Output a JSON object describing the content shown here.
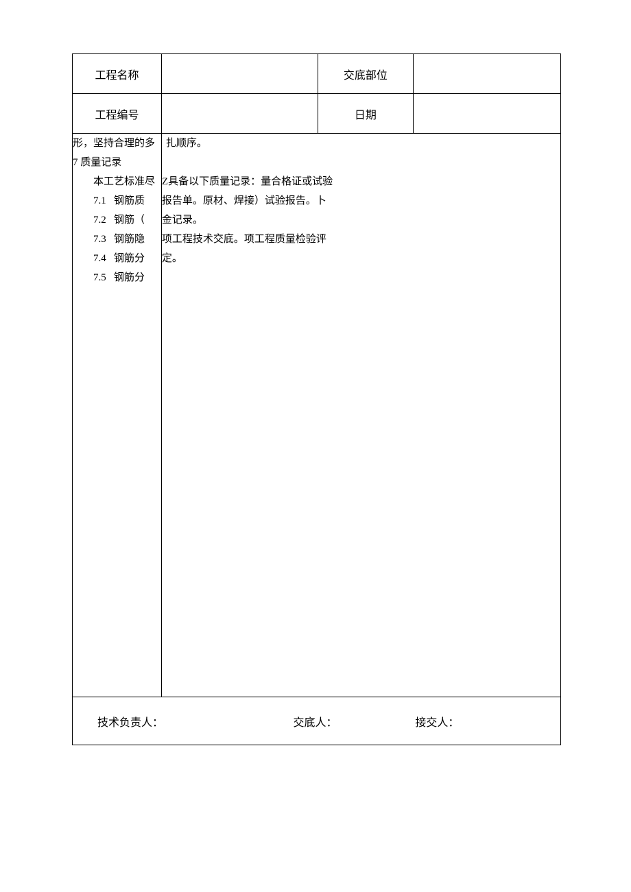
{
  "header": {
    "project_name_label": "工程名称",
    "project_name_value": "",
    "position_label": "交底部位",
    "position_value": "",
    "project_no_label": "工程编号",
    "project_no_value": "",
    "date_label": "日期",
    "date_value": ""
  },
  "body": {
    "left": {
      "line1": "形，坚持合理的多",
      "line2": "7 质量记录",
      "intro_prefix": "本工艺标准尽",
      "items": [
        {
          "no": "7.1",
          "text": "钢筋质"
        },
        {
          "no": "7.2",
          "text": "钢筋（"
        },
        {
          "no": "7.3",
          "text": "钢筋隐"
        },
        {
          "no": "7.4",
          "text": "钢筋分"
        },
        {
          "no": "7.5",
          "text": "钢筋分"
        }
      ]
    },
    "right": {
      "line1": "扎顺序。",
      "para1": "Z具备以下质量记录：量合格证或试验报告单。原材、焊接）试验报告。卜金记录。",
      "para2": "项工程技术交底。项工程质量检验评定。"
    }
  },
  "footer": {
    "tech_lead": "技术负责人：",
    "disclosed_by": "交底人：",
    "received_by": "接交人："
  }
}
